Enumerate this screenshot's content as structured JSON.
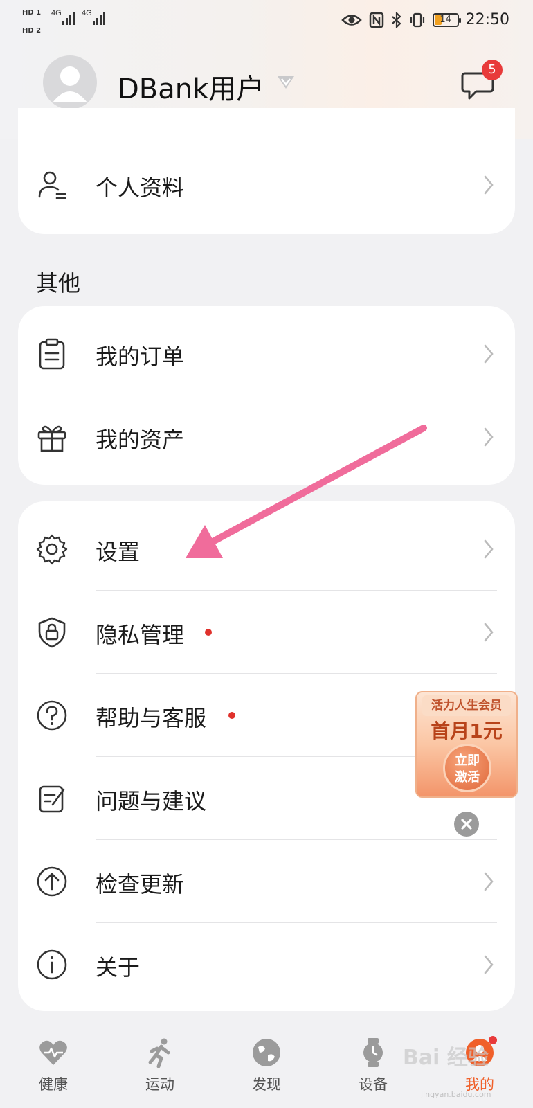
{
  "status_bar": {
    "hd1": "HD 1",
    "hd2": "HD 2",
    "network1": "4G",
    "network2": "4G",
    "battery": "14",
    "time": "22:50"
  },
  "header": {
    "username": "DBank用户",
    "message_badge": "5"
  },
  "account_section": {
    "items": [
      {
        "label": "个人资料",
        "icon": "profile-icon"
      }
    ]
  },
  "other_section": {
    "title": "其他",
    "items": [
      {
        "label": "我的订单",
        "icon": "clipboard-icon"
      },
      {
        "label": "我的资产",
        "icon": "gift-icon"
      }
    ]
  },
  "settings_section": {
    "items": [
      {
        "label": "设置",
        "icon": "gear-icon"
      },
      {
        "label": "隐私管理",
        "icon": "shield-lock-icon",
        "has_dot": true
      },
      {
        "label": "帮助与客服",
        "icon": "question-icon",
        "has_dot": true
      },
      {
        "label": "问题与建议",
        "icon": "feedback-icon"
      },
      {
        "label": "检查更新",
        "icon": "upload-arrow-icon"
      },
      {
        "label": "关于",
        "icon": "info-icon"
      }
    ]
  },
  "promo": {
    "tag": "活力人生会员",
    "headline": "首月1元",
    "cta_line1": "立即",
    "cta_line2": "激活"
  },
  "tabbar": {
    "tabs": [
      {
        "label": "健康",
        "icon": "heart-pulse-icon"
      },
      {
        "label": "运动",
        "icon": "runner-icon"
      },
      {
        "label": "发现",
        "icon": "globe-icon"
      },
      {
        "label": "设备",
        "icon": "watch-icon"
      },
      {
        "label": "我的",
        "icon": "me-icon",
        "active": true
      }
    ]
  },
  "watermark": {
    "text": "Bai 经验",
    "sub": "jingyan.baidu.com"
  },
  "colors": {
    "accent": "#f0602a",
    "badge_red": "#e83a3a",
    "annotation_arrow": "#f06c9b"
  }
}
